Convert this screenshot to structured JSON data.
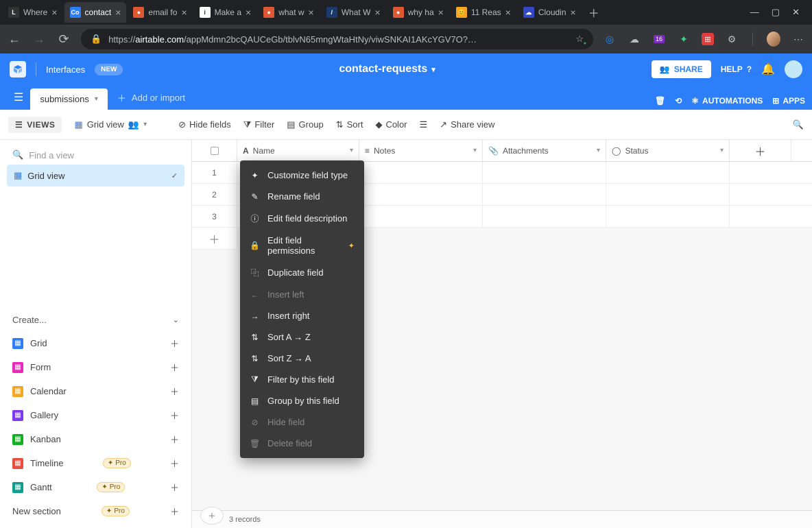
{
  "browser": {
    "tabs": [
      {
        "title": "Where",
        "favicon_bg": "#333",
        "favicon_txt": "L"
      },
      {
        "title": "contact",
        "favicon_bg": "#2d7ff9",
        "favicon_txt": "Co",
        "active": true
      },
      {
        "title": "email fo",
        "favicon_bg": "#de5833",
        "favicon_txt": "●"
      },
      {
        "title": "Make a",
        "favicon_bg": "#fff",
        "favicon_txt": "i"
      },
      {
        "title": "what w",
        "favicon_bg": "#de5833",
        "favicon_txt": "●"
      },
      {
        "title": "What W",
        "favicon_bg": "#1a3a6e",
        "favicon_txt": "/"
      },
      {
        "title": "why ha",
        "favicon_bg": "#de5833",
        "favicon_txt": "●"
      },
      {
        "title": "11 Reas",
        "favicon_bg": "#f5a623",
        "favicon_txt": "😊"
      },
      {
        "title": "Cloudin",
        "favicon_bg": "#3448c5",
        "favicon_txt": "☁"
      }
    ],
    "url_prefix": "https://",
    "url_host": "airtable.com",
    "url_path": "/appMdmn2bcQAUCeGb/tblvN65mngWtaHtNy/viwSNKAI1AKcYGV7O?…",
    "ext_badge": "16"
  },
  "header": {
    "interfaces": "Interfaces",
    "new_badge": "NEW",
    "base_name": "contact-requests",
    "share": "SHARE",
    "help": "HELP",
    "automations": "AUTOMATIONS",
    "apps": "APPS"
  },
  "tabs": {
    "active": "submissions",
    "add_import": "Add or import"
  },
  "toolbar": {
    "views": "VIEWS",
    "grid_view": "Grid view",
    "hide": "Hide fields",
    "filter": "Filter",
    "group": "Group",
    "sort": "Sort",
    "color": "Color",
    "share": "Share view"
  },
  "sidebar": {
    "find_placeholder": "Find a view",
    "active_view": "Grid view",
    "create_label": "Create...",
    "items": [
      {
        "label": "Grid",
        "color": "#2d7ff9"
      },
      {
        "label": "Form",
        "color": "#e929ba"
      },
      {
        "label": "Calendar",
        "color": "#f5a623"
      },
      {
        "label": "Gallery",
        "color": "#7c39ed"
      },
      {
        "label": "Kanban",
        "color": "#11af22"
      },
      {
        "label": "Timeline",
        "color": "#e84d3d",
        "pro": true
      },
      {
        "label": "Gantt",
        "color": "#0f9d8f",
        "pro": true
      }
    ],
    "new_section": "New section",
    "pro_label": "Pro"
  },
  "grid": {
    "columns": [
      {
        "label": "Name",
        "icon": "A"
      },
      {
        "label": "Notes",
        "icon": "≡"
      },
      {
        "label": "Attachments",
        "icon": "📎"
      },
      {
        "label": "Status",
        "icon": "◯"
      }
    ],
    "rows": [
      1,
      2,
      3
    ],
    "record_count": "3 records"
  },
  "context_menu": {
    "items": [
      {
        "label": "Customize field type",
        "icon": "✦"
      },
      {
        "label": "Rename field",
        "icon": "✎"
      },
      {
        "label": "Edit field description",
        "icon": "ⓘ"
      },
      {
        "label": "Edit field permissions",
        "icon": "🔒",
        "sparkle": true
      },
      {
        "label": "Duplicate field",
        "icon": "⿻"
      },
      {
        "label": "Insert left",
        "icon": "←",
        "disabled": true
      },
      {
        "label": "Insert right",
        "icon": "→"
      },
      {
        "label": "Sort A → Z",
        "icon": "⇅"
      },
      {
        "label": "Sort Z → A",
        "icon": "⇅"
      },
      {
        "label": "Filter by this field",
        "icon": "⧩"
      },
      {
        "label": "Group by this field",
        "icon": "▤"
      },
      {
        "label": "Hide field",
        "icon": "⊘",
        "disabled": true
      },
      {
        "label": "Delete field",
        "icon": "🗑",
        "disabled": true
      }
    ]
  }
}
